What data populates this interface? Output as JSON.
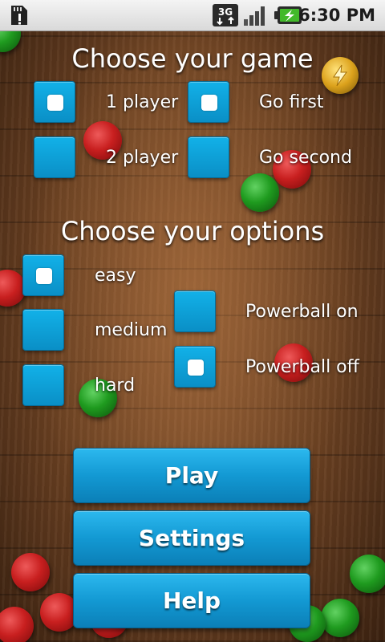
{
  "status_bar": {
    "network_label": "3G",
    "time": "6:30 PM",
    "icons": [
      "notification-sd-icon",
      "network-3g-icon",
      "signal-strength-icon",
      "battery-charging-icon"
    ]
  },
  "game_section": {
    "title": "Choose your game",
    "players": [
      {
        "label": "1 player",
        "checked": true
      },
      {
        "label": "2 player",
        "checked": false
      }
    ],
    "turn_order": [
      {
        "label": "Go first",
        "checked": true
      },
      {
        "label": "Go second",
        "checked": false
      }
    ]
  },
  "options_section": {
    "title": "Choose your options",
    "difficulty": [
      {
        "label": "easy",
        "checked": true
      },
      {
        "label": "medium",
        "checked": false
      },
      {
        "label": "hard",
        "checked": false
      }
    ],
    "powerball": [
      {
        "label": "Powerball on",
        "checked": false
      },
      {
        "label": "Powerball off",
        "checked": true
      }
    ]
  },
  "buttons": {
    "play": "Play",
    "settings": "Settings",
    "help": "Help"
  },
  "colors": {
    "accent_button": "#1399d3",
    "checkbox": "#0fa4dd",
    "text": "#ffffff",
    "wood": "#6b4122"
  }
}
